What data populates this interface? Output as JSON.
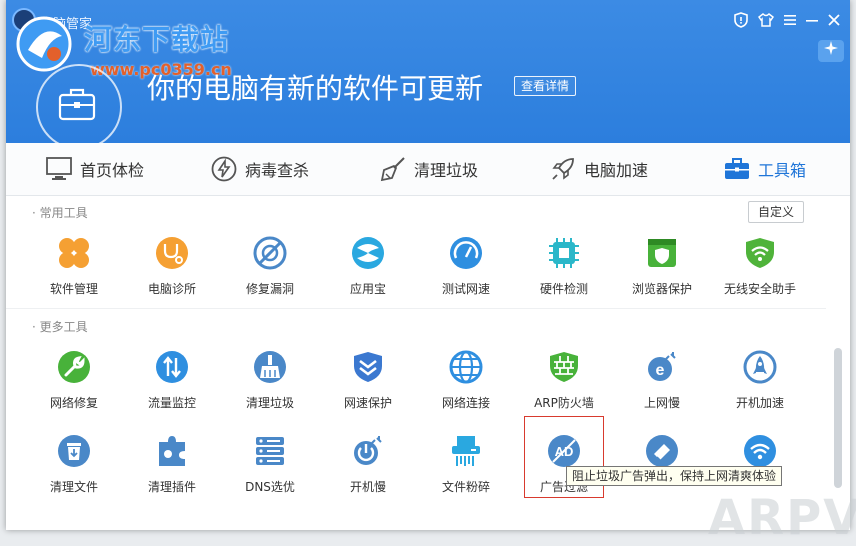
{
  "app": {
    "title": "电脑管家"
  },
  "watermark": {
    "site": "河东下载站",
    "url": "www.pc0359.cn",
    "corner": "ARPVI"
  },
  "banner": {
    "text": "你的电脑有新的软件可更新",
    "detail_label": "查看详情"
  },
  "nav": [
    {
      "label": "首页体检",
      "icon": "monitor-icon"
    },
    {
      "label": "病毒查杀",
      "icon": "lightning-icon"
    },
    {
      "label": "清理垃圾",
      "icon": "broom-icon"
    },
    {
      "label": "电脑加速",
      "icon": "rocket-icon"
    },
    {
      "label": "工具箱",
      "icon": "toolbox-icon"
    }
  ],
  "sections": {
    "common": {
      "title": "· 常用工具",
      "custom_label": "自定义",
      "items": [
        {
          "label": "软件管理",
          "icon": "clover-icon",
          "color": "#f5a033"
        },
        {
          "label": "电脑诊所",
          "icon": "stethoscope-icon",
          "color": "#f5a033"
        },
        {
          "label": "修复漏洞",
          "icon": "patch-icon",
          "color": "#4a88c8"
        },
        {
          "label": "应用宝",
          "icon": "appstore-icon",
          "color": "#2aa8e0"
        },
        {
          "label": "测试网速",
          "icon": "speedometer-icon",
          "color": "#2f8fe0"
        },
        {
          "label": "硬件检测",
          "icon": "chip-icon",
          "color": "#2bb7c9"
        },
        {
          "label": "浏览器保护",
          "icon": "browser-shield-icon",
          "color": "#48b23a"
        },
        {
          "label": "无线安全助手",
          "icon": "wifi-shield-icon",
          "color": "#4fb33a"
        }
      ]
    },
    "more": {
      "title": "· 更多工具",
      "rows": [
        [
          {
            "label": "网络修复",
            "icon": "wrench-icon",
            "color": "#48b23a"
          },
          {
            "label": "流量监控",
            "icon": "updown-arrows-icon",
            "color": "#2f8fe0"
          },
          {
            "label": "清理垃圾",
            "icon": "broom-icon",
            "color": "#4a88c8"
          },
          {
            "label": "网速保护",
            "icon": "shield-chevron-icon",
            "color": "#3b78d0"
          },
          {
            "label": "网络连接",
            "icon": "globe-icon",
            "color": "#2f8fe0"
          },
          {
            "label": "ARP防火墙",
            "icon": "firewall-icon",
            "color": "#48b23a"
          },
          {
            "label": "上网慢",
            "icon": "slow-browser-icon",
            "color": "#4a88c8"
          },
          {
            "label": "开机加速",
            "icon": "rocket-icon",
            "color": "#4a88c8"
          }
        ],
        [
          {
            "label": "清理文件",
            "icon": "trash-icon",
            "color": "#4a88c8"
          },
          {
            "label": "清理插件",
            "icon": "puzzle-icon",
            "color": "#4a88c8"
          },
          {
            "label": "DNS选优",
            "icon": "dns-server-icon",
            "color": "#4a88c8"
          },
          {
            "label": "开机慢",
            "icon": "power-slow-icon",
            "color": "#4a88c8"
          },
          {
            "label": "文件粉碎",
            "icon": "shredder-icon",
            "color": "#2aa8e0"
          },
          {
            "label": "广告过滤",
            "icon": "ad-block-icon",
            "color": "#4a88c8"
          },
          {
            "label": "",
            "icon": "eraser-icon",
            "color": "#4a88c8"
          },
          {
            "label": "",
            "icon": "wifi-icon",
            "color": "#2f8fe0"
          }
        ]
      ]
    }
  },
  "tooltip": {
    "text": "阻止垃圾广告弹出，保持上网清爽体验"
  }
}
